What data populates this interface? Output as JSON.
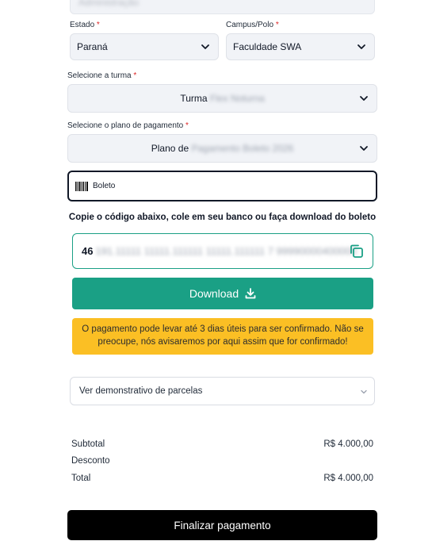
{
  "top_field": {
    "value": "Administração"
  },
  "estado": {
    "label": "Estado",
    "required_mark": "*",
    "value": "Paraná"
  },
  "campus": {
    "label": "Campus/Polo",
    "required_mark": "*",
    "value": "Faculdade SWA"
  },
  "turma": {
    "label": "Selecione a turma",
    "required_mark": "*",
    "value_prefix": "Turma",
    "value_hidden": "Flex Noturna"
  },
  "plano": {
    "label": "Selecione o plano de pagamento",
    "required_mark": "*",
    "value_prefix": "Plano de",
    "value_hidden": "Pagamento Boleto 2026"
  },
  "payment_method": {
    "label": "Boleto",
    "icon": "barcode-icon"
  },
  "instructions": "Copie o código abaixo, cole em seu banco ou faça download do boleto",
  "boleto_code": {
    "visible_prefix": "46",
    "hidden": "191.11111 11111.111111 11111.111111 7 99990000400000"
  },
  "download": {
    "label": "Download"
  },
  "notice": "O pagamento pode levar até 3 dias úteis para ser confirmado. Não se preocupe, nós avisaremos por aqui assim que for confirmado!",
  "parcelas": {
    "label": "Ver demonstrativo de parcelas"
  },
  "summary": {
    "subtotal_label": "Subtotal",
    "subtotal_value": "R$ 4.000,00",
    "desconto_label": "Desconto",
    "total_label": "Total",
    "total_value": "R$ 4.000,00"
  },
  "finalizar": {
    "label": "Finalizar pagamento"
  },
  "colors": {
    "accent": "#1aa085",
    "notice": "#fbbf24",
    "primary_button": "#000000",
    "required": "#dc2626"
  }
}
